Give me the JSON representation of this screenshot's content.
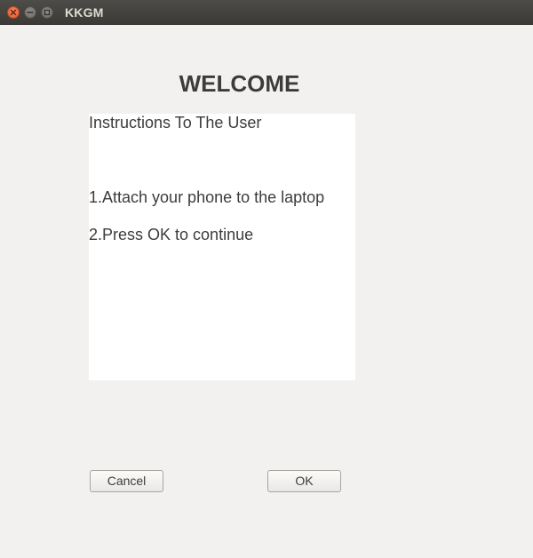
{
  "window": {
    "title": "KKGM"
  },
  "main": {
    "heading": "WELCOME",
    "instructions": {
      "title": "Instructions To The User",
      "lines": [
        "1.Attach your phone to the laptop",
        "2.Press OK to continue"
      ]
    }
  },
  "buttons": {
    "cancel_label": "Cancel",
    "ok_label": "OK"
  },
  "icons": {
    "close": "close-icon",
    "minimize": "minimize-icon",
    "maximize": "maximize-icon"
  },
  "colors": {
    "background": "#f2f1f0",
    "titlebar": "#3b3a37",
    "close_button": "#e2582b",
    "panel": "#ffffff",
    "text": "#3c3c3c"
  }
}
